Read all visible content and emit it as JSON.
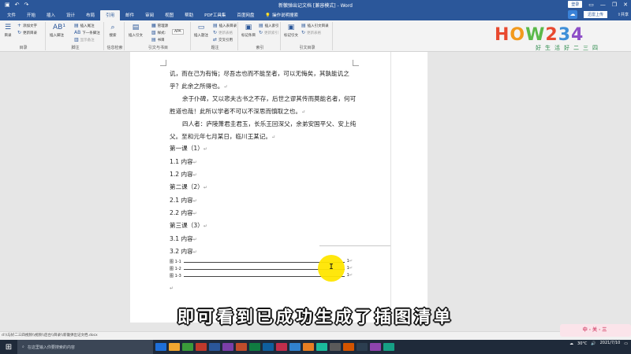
{
  "titlebar": {
    "doc_title": "新徽弹出记文档 [兼容模式] - Word",
    "login": "登录",
    "qat_icons": [
      "save-icon",
      "undo-icon",
      "redo-icon"
    ]
  },
  "tabs": [
    "文件",
    "开始",
    "插入",
    "设计",
    "布局",
    "引用",
    "邮件",
    "审阅",
    "视图",
    "帮助",
    "PDF工具集",
    "百度网盘",
    "操作说明搜索"
  ],
  "active_tab": "引用",
  "share_label": "共享",
  "share_btn": "迅雷上传",
  "ribbon": {
    "toc": {
      "big": "目录",
      "items": [
        "添加文字",
        "更新目录"
      ],
      "group": "目录"
    },
    "footnote": {
      "big": "插入脚注",
      "items": [
        "插入尾注",
        "下一条脚注",
        "显示备注"
      ],
      "group": "脚注"
    },
    "research": {
      "big": "搜索",
      "group": "信息检索"
    },
    "citation": {
      "big": "插入引文",
      "items": [
        "管理源",
        "样式:",
        "书目"
      ],
      "style": "APA",
      "group": "引文与书目"
    },
    "caption": {
      "big": "插入题注",
      "items": [
        "插入表目录",
        "更新表格",
        "交叉引用"
      ],
      "group": "题注"
    },
    "index": {
      "big": "标记条目",
      "items": [
        "插入索引",
        "更新索引"
      ],
      "group": "索引"
    },
    "toa": {
      "big": "标记引文",
      "items": [
        "插入引文目录",
        "更新表格"
      ],
      "group": "引文目录"
    }
  },
  "logo": {
    "main": "HOW234",
    "sub": "好生活好二三四"
  },
  "document": {
    "paragraphs": [
      "讥，而在己为有悔；尽吾志也而不能至者，可以无悔矣，其孰能讥之乎？此余之所得也。",
      "余于仆碑，又以悲夫古书之不存，后世之谬其传而莫能名者，何可胜道也哉！此所以学者不可以不深思而慎取之也。",
      "四人者：庐陵萧君圭君玉，长乐王回深父，余弟安国平父、安上纯父。至和元年七月某日，临川王某记。"
    ],
    "headings": [
      "第一课（1）",
      "1.1 内容",
      "1.2 内容",
      "第二课（2）",
      "2.1 内容",
      "2.2 内容",
      "第三课（3）",
      "3.1 内容",
      "3.2 内容"
    ],
    "figure_list": [
      {
        "label": "图 1-1",
        "page": "1"
      },
      {
        "label": "图 1-2",
        "page": "1"
      },
      {
        "label": "图 1-3",
        "page": "1"
      }
    ],
    "return_mark": "↵"
  },
  "subtitle": "即可看到已成功生成了插图清单",
  "statusbar": {
    "path": "d:\\\\与好二三四视频\\\\视频\\\\后台\\\\目录\\\\新徽弹出记文档.docx"
  },
  "taskbar": {
    "search_placeholder": "在这里输入你要搜索的内容",
    "weather": "30°C",
    "time": "",
    "date": "2021/7/10",
    "app_colors": [
      "#1e6fd9",
      "#f0a630",
      "#3a9b3a",
      "#c0392b",
      "#2b579a",
      "#7b3fa8",
      "#c14c2b",
      "#107c41",
      "#0f5f9e",
      "#c12e4b",
      "#3182ce",
      "#e67e22",
      "#1abc9c",
      "#5a5a5a",
      "#d35400",
      "#2c3e50",
      "#8e44ad",
      "#16a085"
    ]
  },
  "watermark": "中·关·三"
}
